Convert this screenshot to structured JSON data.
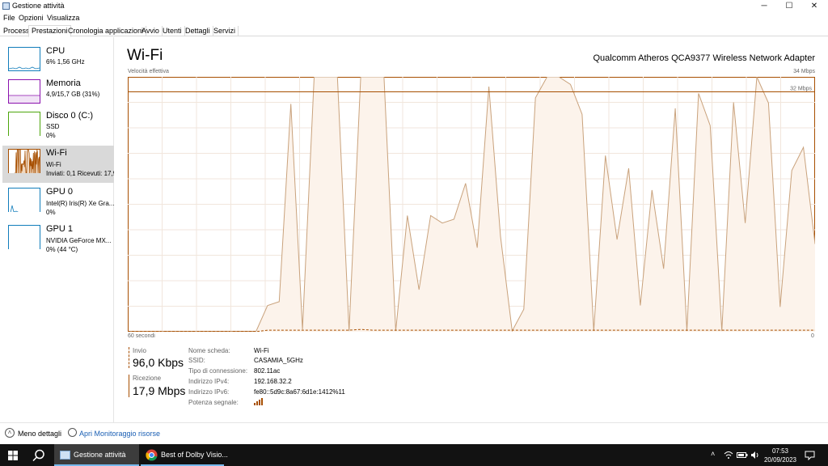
{
  "window": {
    "title": "Gestione attività",
    "minimize": "─",
    "maximize": "☐",
    "close": "✕"
  },
  "menu": [
    "File",
    "Opzioni",
    "Visualizza"
  ],
  "tabs": [
    "Processi",
    "Prestazioni",
    "Cronologia applicazioni",
    "Avvio",
    "Utenti",
    "Dettagli",
    "Servizi"
  ],
  "active_tab": "Prestazioni",
  "sidebar": [
    {
      "title": "CPU",
      "line1": "6% 1,56 GHz",
      "line2": "",
      "color": "#117dbb"
    },
    {
      "title": "Memoria",
      "line1": "4,9/15,7 GB (31%)",
      "line2": "",
      "color": "#8b12ae"
    },
    {
      "title": "Disco 0 (C:)",
      "line1": "SSD",
      "line2": "0%",
      "color": "#4da60c"
    },
    {
      "title": "Wi-Fi",
      "line1": "Wi-Fi",
      "line2": "Inviati: 0,1 Ricevuti: 17,9",
      "color": "#a74f01"
    },
    {
      "title": "GPU 0",
      "line1": "Intel(R) Iris(R) Xe Gra...",
      "line2": "0%",
      "color": "#117dbb"
    },
    {
      "title": "GPU 1",
      "line1": "NVIDIA GeForce MX...",
      "line2": "0% (44 °C)",
      "color": "#117dbb"
    }
  ],
  "main": {
    "title": "Wi-Fi",
    "adapter": "Qualcomm Atheros QCA9377 Wireless Network Adapter",
    "graph_label": "Velocità effettiva",
    "max_label": "34 Mbps",
    "mid_label": "32 Mbps",
    "time_left": "60 secondi",
    "time_right": "0"
  },
  "chart_data": {
    "type": "area",
    "ylim": [
      0,
      34
    ],
    "xlim": [
      60,
      0
    ],
    "series": [
      {
        "values": [
          0,
          0,
          0,
          0,
          0,
          0,
          0,
          0,
          0,
          0,
          0,
          0,
          3.5,
          4,
          30.4,
          0.3,
          34,
          34,
          34,
          0.1,
          34,
          34,
          34,
          0.1,
          15.5,
          5.6,
          15.5,
          14.5,
          15,
          19.8,
          11.2,
          32.7,
          12.7,
          0.1,
          3,
          31.2,
          34,
          34,
          33,
          29,
          0.1,
          23.5,
          12.3,
          21.8,
          3.5,
          18.9,
          8.4,
          29.8,
          0.1,
          31.8,
          27.5,
          0.1,
          30.6,
          14.5,
          34,
          30.5,
          3.3,
          21.5,
          24.6,
          11.7
        ]
      },
      {
        "values": [
          0,
          0,
          0,
          0,
          0,
          0,
          0,
          0,
          0,
          0,
          0,
          0,
          0.2,
          0.2,
          0.2,
          0.2,
          0.2,
          0.2,
          0.2,
          0.2,
          0.3,
          0.2,
          0.2,
          0.2,
          0.2,
          0.2,
          0.2,
          0.2,
          0.2,
          0.2,
          0.2,
          0.2,
          0.2,
          0.2,
          0.2,
          0.2,
          0.2,
          0.2,
          0.2,
          0.2,
          0.2,
          0.2,
          0.2,
          0.2,
          0.2,
          0.2,
          0.2,
          0.2,
          0.2,
          0.2,
          0.2,
          0.2,
          0.2,
          0.2,
          0.2,
          0.2,
          0.2,
          0.2,
          0.2,
          0.2
        ]
      }
    ]
  },
  "stats": {
    "send_label": "Invio",
    "send_value": "96,0 Kbps",
    "recv_label": "Ricezione",
    "recv_value": "17,9 Mbps"
  },
  "details": [
    {
      "label": "Nome scheda:",
      "value": "Wi-Fi"
    },
    {
      "label": "SSID:",
      "value": "CASAMIA_5GHz"
    },
    {
      "label": "Tipo di connessione:",
      "value": "802.11ac"
    },
    {
      "label": "Indirizzo IPv4:",
      "value": "192.168.32.2"
    },
    {
      "label": "Indirizzo IPv6:",
      "value": "fe80::5d9c:8a67:6d1e:1412%11"
    },
    {
      "label": "Potenza segnale:",
      "value": ""
    }
  ],
  "signal_strength": 4,
  "footer": {
    "less": "Meno dettagli",
    "monitor": "Apri Monitoraggio risorse"
  },
  "taskbar": {
    "task_manager": "Gestione attività",
    "chrome": "Best of Dolby Visio...",
    "time": "07:53",
    "date": "20/09/2023"
  },
  "colors": {
    "accent": "#a74f01",
    "fill": "#fcf3eb",
    "selected": "#d9d9d9"
  }
}
